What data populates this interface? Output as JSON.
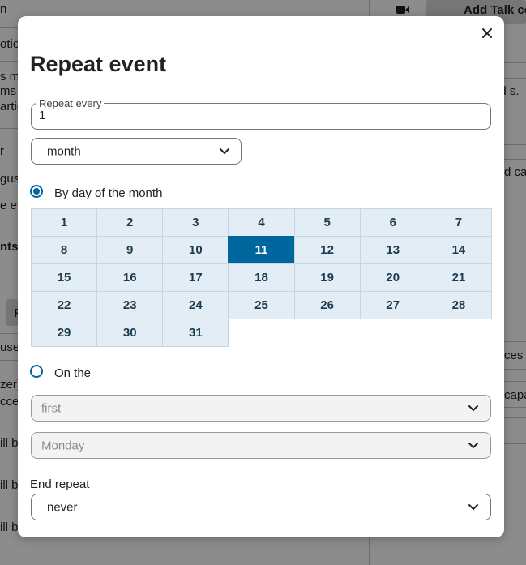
{
  "background": {
    "top_right_button": "Add Talk co",
    "snippets": [
      "n",
      "otio",
      "s me",
      "ms",
      "artic",
      "r",
      "gus",
      "e ev",
      "nts",
      "R",
      "use",
      "zer)",
      "cce",
      "ill b",
      "ill b",
      "ill b",
      "ed s.",
      "d ca",
      "ces c",
      "capa"
    ]
  },
  "modal": {
    "title": "Repeat event",
    "close_icon": "close-icon",
    "repeat_every_label": "Repeat every",
    "repeat_every_value": "1",
    "unit_select_value": "month",
    "by_day_label": "By day of the month",
    "by_day_checked": true,
    "days": [
      "1",
      "2",
      "3",
      "4",
      "5",
      "6",
      "7",
      "8",
      "9",
      "10",
      "11",
      "12",
      "13",
      "14",
      "15",
      "16",
      "17",
      "18",
      "19",
      "20",
      "21",
      "22",
      "23",
      "24",
      "25",
      "26",
      "27",
      "28",
      "29",
      "30",
      "31"
    ],
    "selected_day": "11",
    "on_the_label": "On the",
    "on_the_checked": false,
    "ordinal_select_value": "first",
    "weekday_select_value": "Monday",
    "end_repeat_label": "End repeat",
    "end_repeat_value": "never"
  },
  "colors": {
    "accent": "#00669e",
    "day_bg": "#e2edf5",
    "day_text": "#1d3a4f"
  }
}
